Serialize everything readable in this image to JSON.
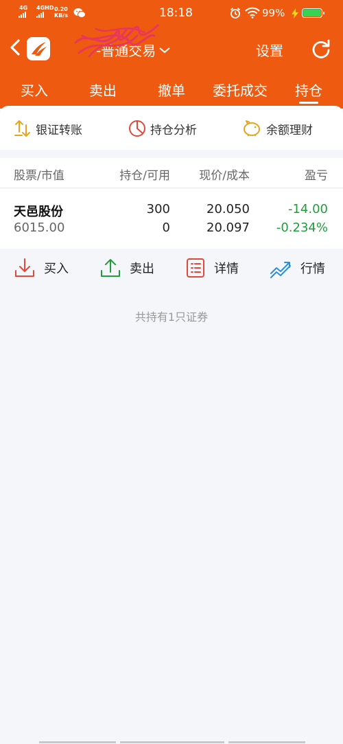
{
  "status_bar": {
    "sig1": "4G",
    "sig2": "4GHD",
    "speed_value": "0.20",
    "speed_unit": "KB/s",
    "time": "18:18",
    "battery_percent": "99%",
    "battery_level": 0.99
  },
  "nav": {
    "title": "-普通交易",
    "settings_label": "设置"
  },
  "tabs": [
    {
      "label": "买入"
    },
    {
      "label": "卖出"
    },
    {
      "label": "撤单"
    },
    {
      "label": "委托成交"
    },
    {
      "label": "持仓",
      "active": true
    }
  ],
  "quick_actions": [
    {
      "label": "银证转账",
      "icon": "transfer-icon"
    },
    {
      "label": "持仓分析",
      "icon": "pie-chart-icon"
    },
    {
      "label": "余额理财",
      "icon": "piggy-bank-icon"
    }
  ],
  "table": {
    "headers": [
      "股票/市值",
      "持仓/可用",
      "现价/成本",
      "盈亏"
    ],
    "rows": [
      {
        "name": "天邑股份",
        "market_value": "6015.00",
        "position": "300",
        "available": "0",
        "price": "20.050",
        "cost": "20.097",
        "pl": "-14.00",
        "pl_pct": "-0.234%"
      }
    ]
  },
  "row_actions": [
    {
      "label": "买入",
      "icon": "download-icon",
      "color": "#e0483a"
    },
    {
      "label": "卖出",
      "icon": "upload-icon",
      "color": "#1f9d3b"
    },
    {
      "label": "详情",
      "icon": "list-icon",
      "color": "#e0483a"
    },
    {
      "label": "行情",
      "icon": "trend-chart-icon",
      "color": "#2a8fd8"
    }
  ],
  "summary_text": "共持有1只证券",
  "colors": {
    "brand_orange": "#ee5a10",
    "gain_green": "#1f9d3b",
    "sell_red": "#e0483a",
    "blue": "#2a8fd8"
  }
}
